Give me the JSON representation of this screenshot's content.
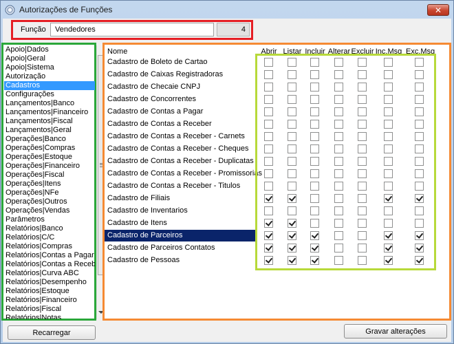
{
  "window": {
    "title": "Autorizações de Funções",
    "close_label": "✕"
  },
  "funcao": {
    "label": "Função",
    "value": "Vendedores",
    "code": "4"
  },
  "list": {
    "items": [
      "Apoio|Dados",
      "Apoio|Geral",
      "Apoio|Sistema",
      "Autorização",
      "Cadastros",
      "Configurações",
      "Lançamentos|Banco",
      "Lançamentos|Financeiro",
      "Lançamentos|Fiscal",
      "Lançamentos|Geral",
      "Operações|Banco",
      "Operações|Compras",
      "Operações|Estoque",
      "Operações|Financeiro",
      "Operações|Fiscal",
      "Operações|Itens",
      "Operações|NFe",
      "Operações|Outros",
      "Operações|Vendas",
      "Parâmetros",
      "Relatórios|Banco",
      "Relatórios|C/C",
      "Relatórios|Compras",
      "Relatórios|Contas a Pagar",
      "Relatórios|Contas a Receber",
      "Relatórios|Curva ABC",
      "Relatórios|Desempenho",
      "Relatórios|Estoque",
      "Relatórios|Financeiro",
      "Relatórios|Fiscal",
      "Relatórios|Notas"
    ],
    "selected_index": 4
  },
  "grid": {
    "headers": [
      "Nome",
      "Abrir",
      "Listar",
      "Incluir",
      "Alterar",
      "Excluir",
      "Inc.Msg",
      "Exc.Msg"
    ],
    "rows": [
      {
        "name": "Cadastro de Boleto de Cartao",
        "checks": [
          false,
          false,
          false,
          false,
          false,
          false,
          false
        ]
      },
      {
        "name": "Cadastro de Caixas Registradoras",
        "checks": [
          false,
          false,
          false,
          false,
          false,
          false,
          false
        ]
      },
      {
        "name": "Cadastro de Checaie CNPJ",
        "checks": [
          false,
          false,
          false,
          false,
          false,
          false,
          false
        ]
      },
      {
        "name": "Cadastro de Concorrentes",
        "checks": [
          false,
          false,
          false,
          false,
          false,
          false,
          false
        ]
      },
      {
        "name": "Cadastro de Contas a Pagar",
        "checks": [
          false,
          false,
          false,
          false,
          false,
          false,
          false
        ]
      },
      {
        "name": "Cadastro de Contas a Receber",
        "checks": [
          false,
          false,
          false,
          false,
          false,
          false,
          false
        ]
      },
      {
        "name": "Cadastro de Contas a Receber - Carnets",
        "checks": [
          false,
          false,
          false,
          false,
          false,
          false,
          false
        ]
      },
      {
        "name": "Cadastro de Contas a Receber - Cheques",
        "checks": [
          false,
          false,
          false,
          false,
          false,
          false,
          false
        ]
      },
      {
        "name": "Cadastro de Contas a Receber - Duplicatas",
        "checks": [
          false,
          false,
          false,
          false,
          false,
          false,
          false
        ]
      },
      {
        "name": "Cadastro de Contas a Receber - Promissorias",
        "checks": [
          false,
          false,
          false,
          false,
          false,
          false,
          false
        ]
      },
      {
        "name": "Cadastro de Contas a Receber - Titulos",
        "checks": [
          false,
          false,
          false,
          false,
          false,
          false,
          false
        ]
      },
      {
        "name": "Cadastro de Filiais",
        "checks": [
          true,
          true,
          false,
          false,
          false,
          true,
          true
        ]
      },
      {
        "name": "Cadastro de Inventarios",
        "checks": [
          false,
          false,
          false,
          false,
          false,
          false,
          false
        ]
      },
      {
        "name": "Cadastro de Itens",
        "checks": [
          true,
          true,
          false,
          false,
          false,
          false,
          false
        ]
      },
      {
        "name": "Cadastro de Parceiros",
        "checks": [
          true,
          true,
          true,
          false,
          false,
          true,
          true
        ]
      },
      {
        "name": "Cadastro de Parceiros Contatos",
        "checks": [
          true,
          true,
          true,
          false,
          false,
          true,
          true
        ]
      },
      {
        "name": "Cadastro de Pessoas",
        "checks": [
          true,
          true,
          true,
          false,
          false,
          true,
          true
        ]
      }
    ],
    "selected_index": 14
  },
  "buttons": {
    "reload": "Recarregar",
    "save": "Gravar alterações"
  }
}
